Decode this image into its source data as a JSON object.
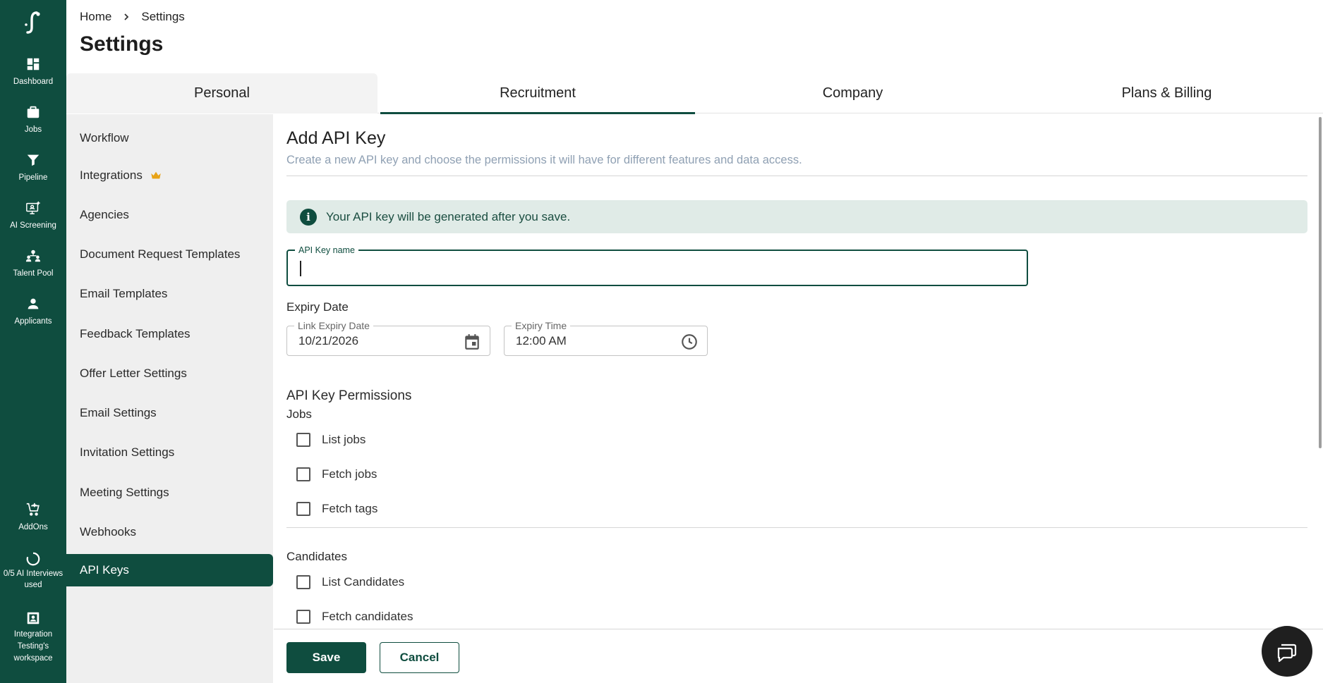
{
  "rail": {
    "items": [
      {
        "label": "Dashboard",
        "icon": "dashboard-icon"
      },
      {
        "label": "Jobs",
        "icon": "briefcase-icon"
      },
      {
        "label": "Pipeline",
        "icon": "filter-icon"
      },
      {
        "label": "AI Screening",
        "icon": "ai-screening-icon"
      },
      {
        "label": "Talent Pool",
        "icon": "talent-pool-icon"
      },
      {
        "label": "Applicants",
        "icon": "person-icon"
      }
    ],
    "bottom": [
      {
        "label": "AddOns",
        "icon": "cart-add-icon"
      },
      {
        "label": "0/5 AI Interviews used",
        "icon": "progress-ring-icon"
      },
      {
        "label": "Integration Testing's workspace",
        "icon": "workspace-icon"
      }
    ]
  },
  "breadcrumb": {
    "home": "Home",
    "current": "Settings"
  },
  "page_title": "Settings",
  "tabs": [
    "Personal",
    "Recruitment",
    "Company",
    "Plans & Billing"
  ],
  "active_tab": "Recruitment",
  "subnav": [
    "Workflow",
    "Integrations",
    "Agencies",
    "Document Request Templates",
    "Email Templates",
    "Feedback Templates",
    "Offer Letter Settings",
    "Email Settings",
    "Invitation Settings",
    "Meeting Settings",
    "Webhooks",
    "API Keys"
  ],
  "active_subnav": "API Keys",
  "form": {
    "title": "Add API Key",
    "subtitle": "Create a new API key and choose the permissions it will have for different features and data access.",
    "alert": "Your API key will be generated after you save.",
    "key_name_label": "API Key name",
    "key_name_value": "",
    "expiry_heading": "Expiry Date",
    "date_label": "Link Expiry Date",
    "date_value": "10/21/2026",
    "time_label": "Expiry Time",
    "time_value": "12:00 AM",
    "permissions_heading": "API Key Permissions",
    "groups": [
      {
        "name": "Jobs",
        "items": [
          "List jobs",
          "Fetch jobs",
          "Fetch tags"
        ]
      },
      {
        "name": "Candidates",
        "items": [
          "List Candidates",
          "Fetch candidates"
        ]
      }
    ]
  },
  "actions": {
    "save": "Save",
    "cancel": "Cancel"
  },
  "colors": {
    "brand": "#0f4d3f",
    "alert_bg": "#e0ebe7",
    "crown": "#e8a317"
  }
}
